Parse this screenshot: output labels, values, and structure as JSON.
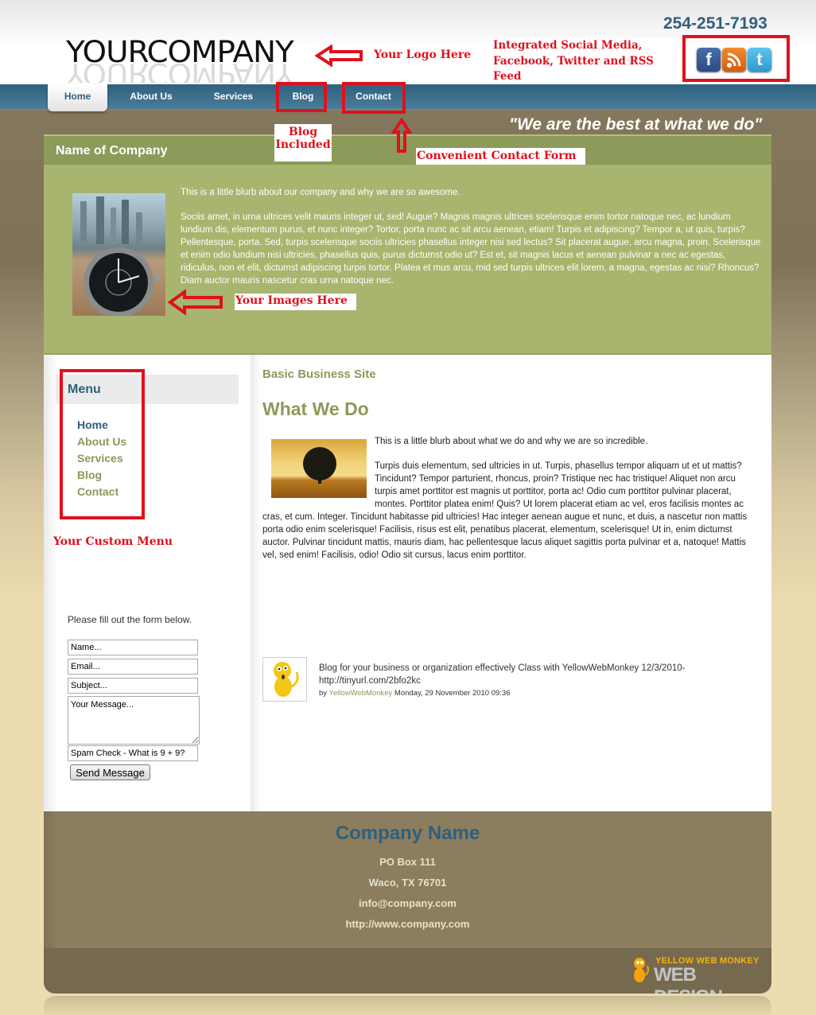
{
  "header": {
    "logo_text": "YOURCOMPANY",
    "phone": "254-251-7193",
    "social_icons": [
      {
        "name": "facebook-icon",
        "glyph": "f"
      },
      {
        "name": "rss-icon",
        "glyph": "◣"
      },
      {
        "name": "twitter-icon",
        "glyph": "t"
      }
    ]
  },
  "nav": {
    "items": [
      {
        "label": "Home",
        "active": true
      },
      {
        "label": "About Us"
      },
      {
        "label": "Services"
      },
      {
        "label": "Blog"
      },
      {
        "label": "Contact"
      }
    ]
  },
  "tagline": "\"We are the best at what we do\"",
  "annotations": {
    "logo": "Your Logo Here",
    "social": "Integrated Social Media, Facebook, Twitter and RSS Feed",
    "blog": "Blog Included",
    "contact": "Convenient Contact Form",
    "images": "Your Images Here",
    "menu": "Your Custom  Menu"
  },
  "hero": {
    "title": "Name of Company",
    "intro": "This is a little blurb about our company and why we are so awesome.",
    "body": "Sociis amet, in urna ultrices velit mauris integer ut, sed! Augue? Magnis magnis ultrices scelerisque enim tortor natoque nec, ac lundium lundium dis, elementum purus, et nunc integer? Tortor, porta nunc ac sit arcu aenean, etiam! Turpis et adipiscing? Tempor a, ut quis, turpis? Pellentesque, porta. Sed, turpis scelerisque sociis ultricies phasellus integer nisi sed lectus? Sit placerat augue, arcu magna, proin. Scelerisque et enim odio lundium nisi ultricies, phasellus quis, purus dictumst odio ut? Est et, sit magnis lacus et aenean pulvinar a nec ac egestas, ridiculus, non et elit, dictumst adipiscing turpis tortor. Platea et mus arcu, mid sed turpis ultrices elit lorem, a magna, egestas ac nisi? Rhoncus? Diam auctor mauris nascetur cras urna natoque nec."
  },
  "sidebar": {
    "menu_title": "Menu",
    "menu_items": [
      {
        "label": "Home",
        "active": true
      },
      {
        "label": "About Us"
      },
      {
        "label": "Services"
      },
      {
        "label": "Blog"
      },
      {
        "label": "Contact"
      }
    ],
    "form": {
      "intro": "Please fill out the form below.",
      "name_value": "Name...",
      "email_value": "Email...",
      "subject_value": "Subject...",
      "message_value": "Your Message...",
      "spam_value": "Spam Check - What is 9 + 9?",
      "submit_label": "Send Message"
    }
  },
  "content": {
    "subtitle": "Basic Business Site",
    "title": "What We Do",
    "intro": "This is a little blurb about what we do and why we are so incredible.",
    "body": "Turpis duis elementum, sed ultricies in ut. Turpis, phasellus tempor aliquam ut et ut mattis? Tincidunt? Tempor parturient, rhoncus, proin? Tristique nec hac tristique! Aliquet non arcu turpis amet porttitor est magnis ut porttitor, porta ac! Odio cum porttitor pulvinar placerat, montes. Porttitor platea enim! Quis? Ut lorem placerat etiam ac vel, eros facilisis montes ac cras, et cum. Integer. Tincidunt habitasse pid ultricies! Hac integer aenean augue et nunc, et duis, a nascetur non mattis porta odio enim scelerisque! Facilisis, risus est elit, penatibus placerat, elementum, scelerisque! Ut in, enim dictumst auctor. Pulvinar tincidunt mattis, mauris diam, hac pellentesque lacus aliquet sagittis porta pulvinar et a, natoque! Mattis vel, sed enim! Facilisis, odio! Odio sit cursus, lacus enim porttitor.",
    "blog_post": {
      "text": "Blog for your business or organization effectively Class with YellowWebMonkey 12/3/2010- http://tinyurl.com/2bfo2kc",
      "by": "by",
      "author": "YellowWebMonkey",
      "date": "Monday, 29 November 2010 09:36"
    }
  },
  "footer": {
    "company_name": "Company Name",
    "po_box": "PO Box 111",
    "city": "Waco, TX 76701",
    "email": "info@company.com",
    "website": "http://www.company.com",
    "credit_top": "YELLOW WEB MONKEY",
    "credit_bottom": "WEB DESIGN"
  },
  "colors": {
    "brand_blue": "#2f5f7d",
    "olive": "#8c9a5a",
    "hero_green": "#a7b56e",
    "footer_brown": "#8b7d5e",
    "annotation_red": "#e0101c"
  }
}
